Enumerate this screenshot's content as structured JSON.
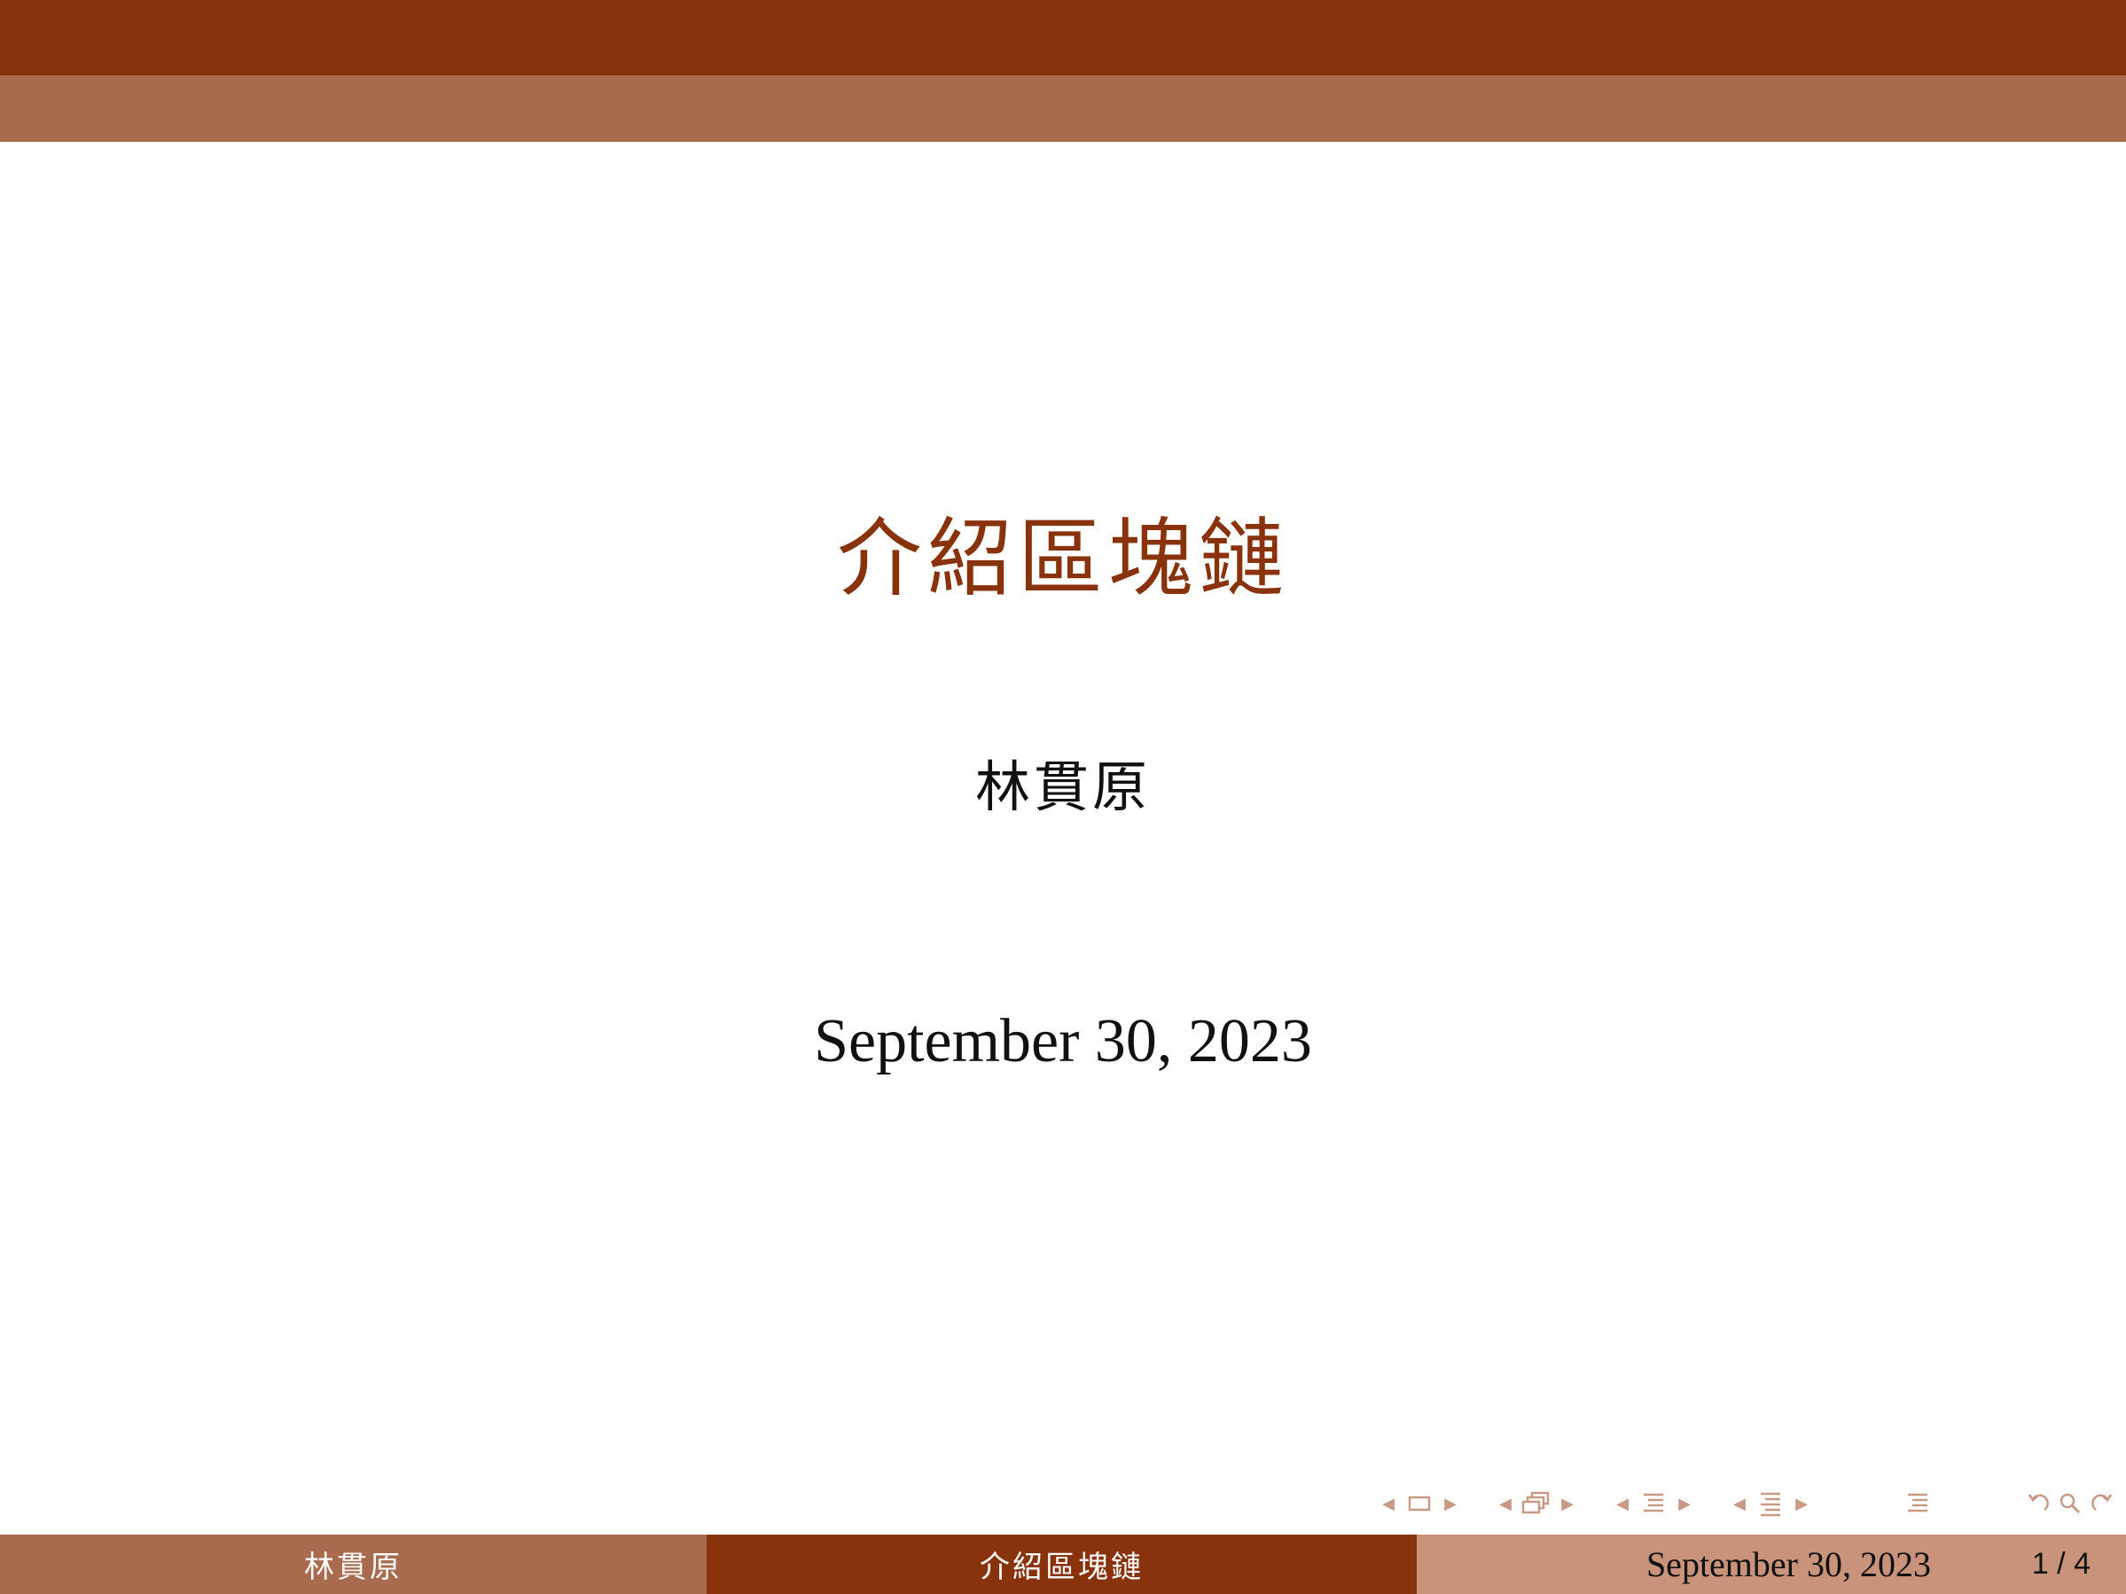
{
  "slide": {
    "title": "介紹區塊鏈",
    "author": "林貫原",
    "date": "September 30, 2023"
  },
  "footer": {
    "author": "林貫原",
    "title": "介紹區塊鏈",
    "date": "September 30, 2023",
    "page": "1 / 4"
  },
  "colors": {
    "primary": "#88330c",
    "secondary": "#a86b4d",
    "tertiary": "#c9937b",
    "nav_symbols": "#c89a86"
  },
  "navigation": {
    "icons": [
      "nav-frame-icon",
      "nav-subsection-icon",
      "nav-section-icon",
      "nav-document-icon",
      "nav-outline-icon",
      "nav-back-icon",
      "nav-search-icon",
      "nav-forward-icon"
    ]
  }
}
